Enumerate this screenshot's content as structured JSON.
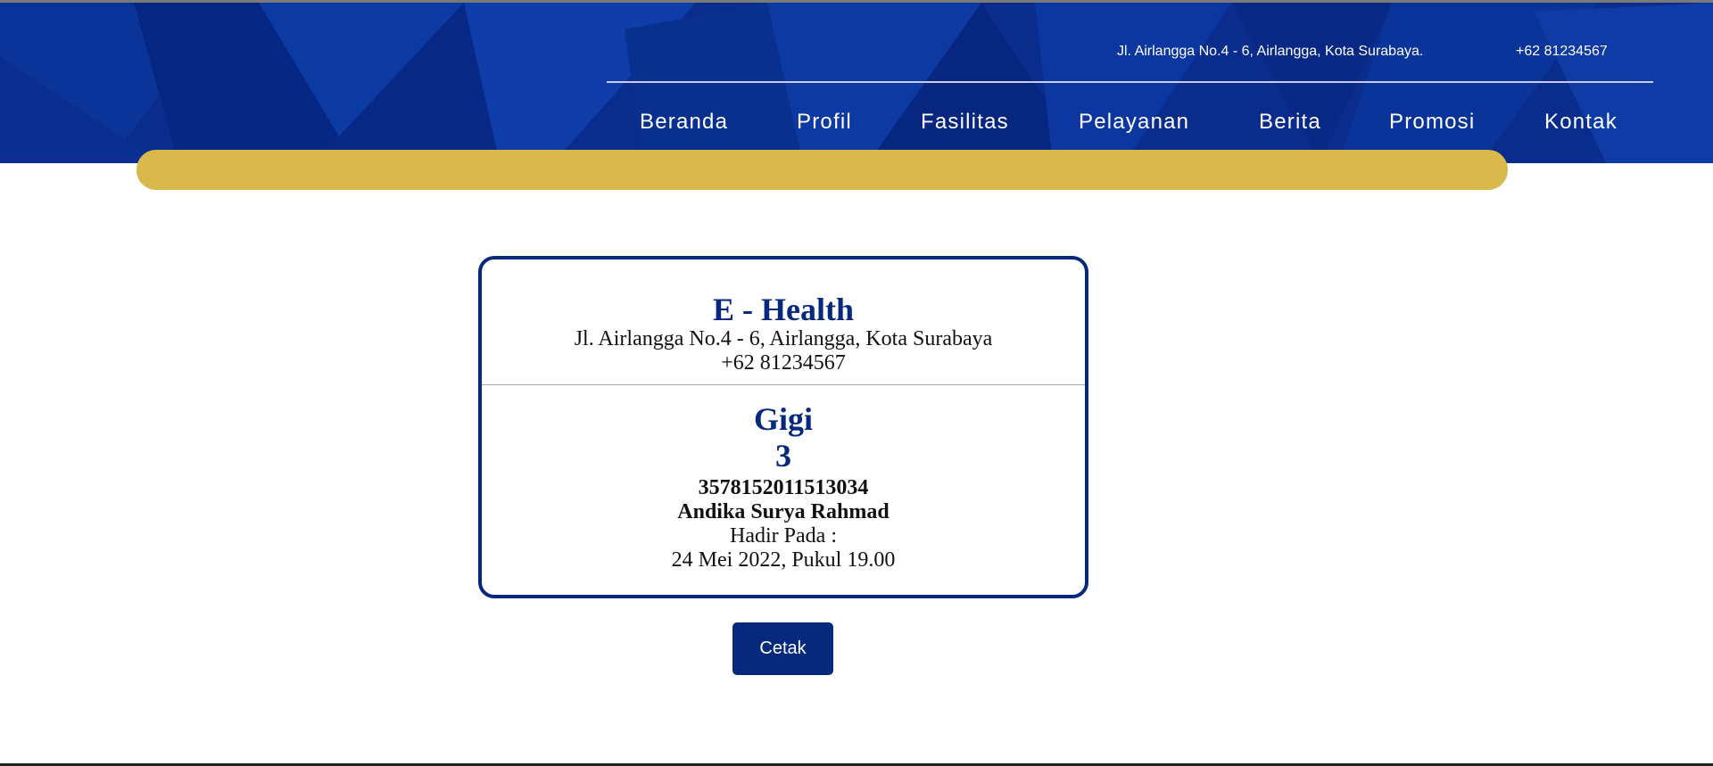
{
  "header": {
    "address": "Jl. Airlangga No.4 - 6, Airlangga, Kota Surabaya.",
    "phone": "+62 81234567",
    "nav": [
      {
        "label": "Beranda"
      },
      {
        "label": "Profil"
      },
      {
        "label": "Fasilitas"
      },
      {
        "label": "Pelayanan"
      },
      {
        "label": "Berita"
      },
      {
        "label": "Promosi"
      },
      {
        "label": "Kontak"
      }
    ]
  },
  "ticket": {
    "clinic_name": "E - Health",
    "clinic_address": "Jl. Airlangga No.4 - 6, Airlangga, Kota Surabaya",
    "clinic_phone": "+62 81234567",
    "poly": "Gigi",
    "queue_number": "3",
    "nik": "3578152011513034",
    "patient_name": "Andika Surya Rahmad",
    "attend_label": "Hadir Pada :",
    "attend_datetime": "24 Mei 2022, Pukul 19.00"
  },
  "actions": {
    "print_label": "Cetak"
  },
  "colors": {
    "header_blue": "#0a2c8c",
    "accent_gold": "#d9b84c",
    "brand_navy": "#06297e"
  }
}
